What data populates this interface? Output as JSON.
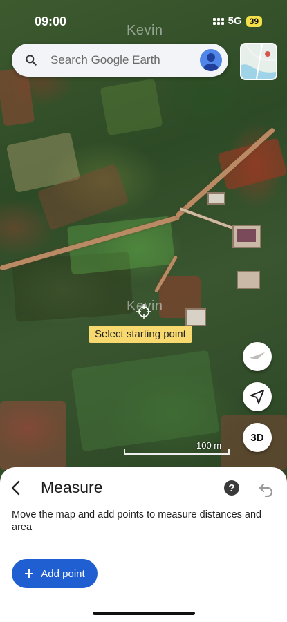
{
  "status": {
    "time": "09:00",
    "network": "5G",
    "battery": "39"
  },
  "map": {
    "ghost_labels": [
      "Kevin",
      "Kevin"
    ],
    "hint": "Select starting point",
    "scale_label": "100 m",
    "three_d_label": "3D"
  },
  "search": {
    "placeholder": "Search Google Earth"
  },
  "sheet": {
    "title": "Measure",
    "help_label": "?",
    "description": "Move the map and add points to measure distances and area",
    "add_point_label": "Add point"
  },
  "colors": {
    "accent": "#1f5fd1",
    "hint_bg": "#f7d96f",
    "battery": "#f5e04a"
  }
}
